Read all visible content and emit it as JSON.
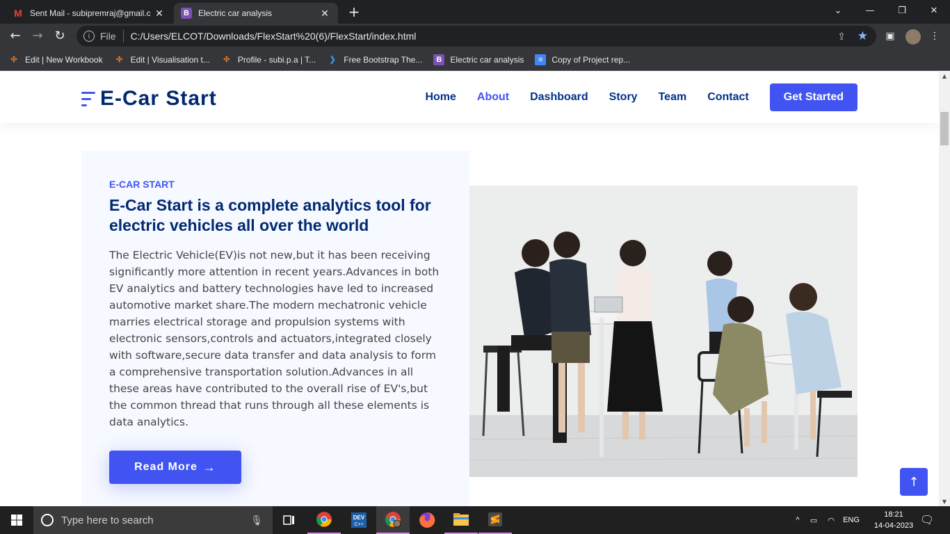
{
  "browser": {
    "tabs": [
      {
        "title": "Sent Mail - subipremraj@gmail.c",
        "icon": "gmail-icon",
        "active": false
      },
      {
        "title": "Electric car analysis",
        "icon": "bootstrap-icon",
        "active": true
      }
    ],
    "address": {
      "scheme_label": "File",
      "url": "C:/Users/ELCOT/Downloads/FlexStart%20(6)/FlexStart/index.html"
    },
    "bookmarks": [
      {
        "label": "Edit | New Workbook",
        "icon": "tableau-icon"
      },
      {
        "label": "Edit | Visualisation t...",
        "icon": "tableau-icon"
      },
      {
        "label": "Profile - subi.p.a | T...",
        "icon": "tableau-icon"
      },
      {
        "label": "Free Bootstrap The...",
        "icon": "bootstrap-made-icon"
      },
      {
        "label": "Electric car analysis",
        "icon": "bootstrap-icon"
      },
      {
        "label": "Copy of Project rep...",
        "icon": "google-docs-icon"
      }
    ]
  },
  "site": {
    "brand": "E-Car Start",
    "nav": [
      "Home",
      "About",
      "Dashboard",
      "Story",
      "Team",
      "Contact"
    ],
    "active_nav": "About",
    "cta": "Get Started",
    "accent_color": "#4154f1",
    "heading_color": "#012970"
  },
  "about": {
    "kicker": "E-CAR START",
    "headline": "E-Car Start is a complete analytics tool for electric vehicles all over the world",
    "paragraph": "The Electric Vehicle(EV)is not new,but it has been receiving significantly more attention in recent years.Advances in both EV analytics and battery technologies have led to increased automotive market share.The modern mechatronic vehicle marries electrical storage and propulsion systems with electronic sensors,controls and actuators,integrated closely with software,secure data transfer and data analysis to form a comprehensive transportation solution.Advances in all these areas have contributed to the overall rise of EV's,but the common thread that runs through all these elements is data analytics.",
    "button": "Read More",
    "image_desc": "team-photo"
  },
  "taskbar": {
    "search_placeholder": "Type here to search",
    "language": "ENG",
    "time": "18:21",
    "date": "14-04-2023"
  }
}
